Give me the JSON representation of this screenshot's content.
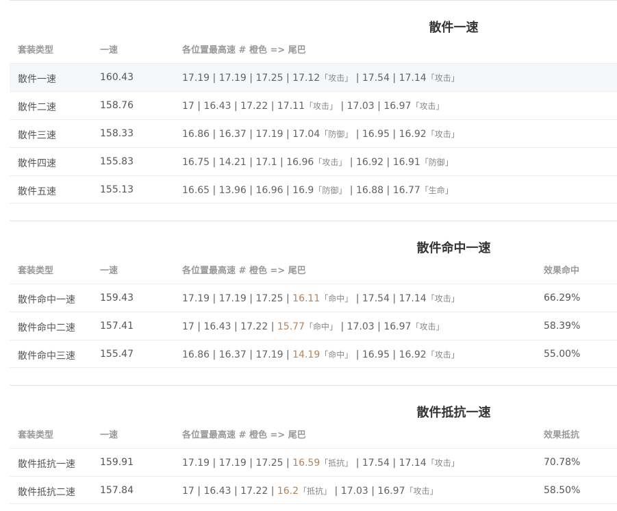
{
  "sections": [
    {
      "title": "散件一速",
      "headers": {
        "type": "套装类型",
        "speed": "一速",
        "positions": "各位置最高速 # 橙色 => 尾巴",
        "extra": ""
      },
      "rows": [
        {
          "type": "散件一速",
          "speed": "160.43",
          "pos": [
            "17.19",
            "17.19",
            "17.25",
            "17.12"
          ],
          "tag4": "「攻击」",
          "pos5": "17.54",
          "pos6": "17.14",
          "tag6": "「攻击」",
          "extra": "",
          "highlighted": true
        },
        {
          "type": "散件二速",
          "speed": "158.76",
          "pos": [
            "17",
            "16.43",
            "17.22",
            "17.11"
          ],
          "tag4": "「攻击」",
          "pos5": "17.03",
          "pos6": "16.97",
          "tag6": "「攻击」",
          "extra": ""
        },
        {
          "type": "散件三速",
          "speed": "158.33",
          "pos": [
            "16.86",
            "16.37",
            "17.19",
            "17.04"
          ],
          "tag4": "「防御」",
          "pos5": "16.95",
          "pos6": "16.92",
          "tag6": "「攻击」",
          "extra": ""
        },
        {
          "type": "散件四速",
          "speed": "155.83",
          "pos": [
            "16.75",
            "14.21",
            "17.1",
            "16.96"
          ],
          "tag4": "「攻击」",
          "pos5": "16.92",
          "pos6": "16.91",
          "tag6": "「防御」",
          "extra": ""
        },
        {
          "type": "散件五速",
          "speed": "155.13",
          "pos": [
            "16.65",
            "13.96",
            "16.96",
            "16.9"
          ],
          "tag4": "「防御」",
          "pos5": "16.88",
          "pos6": "16.77",
          "tag6": "「生命」",
          "extra": ""
        }
      ]
    },
    {
      "title": "散件命中一速",
      "headers": {
        "type": "套装类型",
        "speed": "一速",
        "positions": "各位置最高速 # 橙色 => 尾巴",
        "extra": "效果命中"
      },
      "rows": [
        {
          "type": "散件命中一速",
          "speed": "159.43",
          "pos": [
            "17.19",
            "17.19",
            "17.25",
            "16.11"
          ],
          "tag4": "「命中」",
          "pos5": "17.54",
          "pos6": "17.14",
          "tag6": "「攻击」",
          "extra": "66.29%",
          "orange4": true
        },
        {
          "type": "散件命中二速",
          "speed": "157.41",
          "pos": [
            "17",
            "16.43",
            "17.22",
            "15.77"
          ],
          "tag4": "「命中」",
          "pos5": "17.03",
          "pos6": "16.97",
          "tag6": "「攻击」",
          "extra": "58.39%",
          "orange4": true
        },
        {
          "type": "散件命中三速",
          "speed": "155.47",
          "pos": [
            "16.86",
            "16.37",
            "17.19",
            "14.19"
          ],
          "tag4": "「命中」",
          "pos5": "16.95",
          "pos6": "16.92",
          "tag6": "「攻击」",
          "extra": "55.00%",
          "orange4": true
        }
      ]
    },
    {
      "title": "散件抵抗一速",
      "headers": {
        "type": "套装类型",
        "speed": "一速",
        "positions": "各位置最高速 # 橙色 => 尾巴",
        "extra": "效果抵抗"
      },
      "rows": [
        {
          "type": "散件抵抗一速",
          "speed": "159.91",
          "pos": [
            "17.19",
            "17.19",
            "17.25",
            "16.59"
          ],
          "tag4": "「抵抗」",
          "pos5": "17.54",
          "pos6": "17.14",
          "tag6": "「攻击」",
          "extra": "70.78%",
          "orange4": true
        },
        {
          "type": "散件抵抗二速",
          "speed": "157.84",
          "pos": [
            "17",
            "16.43",
            "17.22",
            "16.2"
          ],
          "tag4": "「抵抗」",
          "pos5": "17.03",
          "pos6": "16.97",
          "tag6": "「攻击」",
          "extra": "58.50%",
          "orange4": true
        }
      ]
    }
  ],
  "colors": {
    "orange": "#b5835a",
    "header": "#999999",
    "title": "#333333",
    "highlight": "#f5f7fa"
  }
}
